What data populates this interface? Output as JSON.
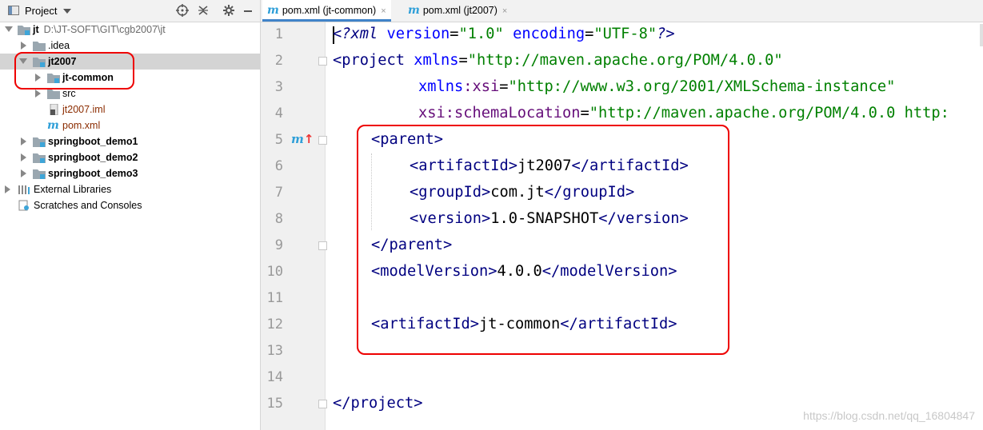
{
  "project_panel": {
    "title": "Project",
    "tree": [
      {
        "label": "jt",
        "path": "D:\\JT-SOFT\\GIT\\cgb2007\\jt"
      },
      {
        "label": ".idea"
      },
      {
        "label": "jt2007"
      },
      {
        "label": "jt-common"
      },
      {
        "label": "src"
      },
      {
        "label": "jt2007.iml"
      },
      {
        "label": "pom.xml"
      },
      {
        "label": "springboot_demo1"
      },
      {
        "label": "springboot_demo2"
      },
      {
        "label": "springboot_demo3"
      },
      {
        "label": "External Libraries"
      },
      {
        "label": "Scratches and Consoles"
      }
    ]
  },
  "tabs": [
    {
      "icon": "m",
      "label": "pom.xml (jt-common)",
      "close": "×",
      "active": true
    },
    {
      "icon": "m",
      "label": "pom.xml (jt2007)",
      "close": "×",
      "active": false
    }
  ],
  "editor": {
    "line_numbers": [
      "1",
      "2",
      "3",
      "4",
      "5",
      "6",
      "7",
      "8",
      "9",
      "10",
      "11",
      "12",
      "13",
      "14",
      "15"
    ],
    "lines": {
      "l1": {
        "a": "<?xml ",
        "b": "version",
        "c": "=",
        "d": "\"1.0\"",
        "e": " ",
        "f": "encoding",
        "g": "=",
        "h": "\"UTF-8\"",
        "i": "?>"
      },
      "l2": {
        "a": "<project ",
        "b": "xmlns",
        "c": "=",
        "d": "\"http://maven.apache.org/POM/4.0.0\""
      },
      "l3": {
        "a": "xmlns",
        "b": ":xsi",
        "c": "=",
        "d": "\"http://www.w3.org/2001/XMLSchema-instance\""
      },
      "l4": {
        "a": "xsi",
        "b": ":schemaLocation",
        "c": "=",
        "d": "\"http://maven.apache.org/POM/4.0.0 http:"
      },
      "l5": {
        "a": "<parent>"
      },
      "l6": {
        "a": "<artifactId>",
        "b": "jt2007",
        "c": "</artifactId>"
      },
      "l7": {
        "a": "<groupId>",
        "b": "com.jt",
        "c": "</groupId>"
      },
      "l8": {
        "a": "<version>",
        "b": "1.0-SNAPSHOT",
        "c": "</version>"
      },
      "l9": {
        "a": "</parent>"
      },
      "l10": {
        "a": "<modelVersion>",
        "b": "4.0.0",
        "c": "</modelVersion>"
      },
      "l12": {
        "a": "<artifactId>",
        "b": "jt-common",
        "c": "</artifactId>"
      },
      "l15": {
        "a": "</project>"
      }
    },
    "gutter_marker": "m"
  },
  "watermark": "https://blog.csdn.net/qq_16804847",
  "colors": {
    "tag": "#000080",
    "attr": "#0000ff",
    "value": "#008000",
    "highlight_box": "#e00000",
    "selection": "#d4d4d4"
  }
}
